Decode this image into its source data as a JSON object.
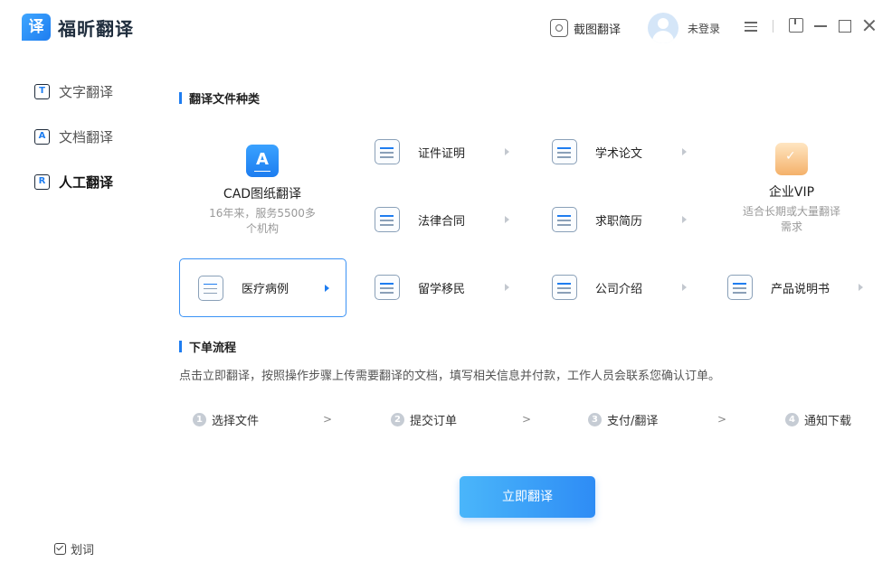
{
  "app": {
    "logo_char": "译",
    "name": "福昕翻译"
  },
  "header": {
    "screenshot_label": "截图翻译",
    "login_label": "未登录"
  },
  "sidebar": {
    "items": [
      {
        "label": "文字翻译",
        "icon": "T"
      },
      {
        "label": "文档翻译",
        "icon": "A"
      },
      {
        "label": "人工翻译",
        "icon": "R"
      }
    ],
    "huaci_label": "划词"
  },
  "file_types": {
    "title": "翻译文件种类",
    "cad": {
      "title": "CAD图纸翻译",
      "desc_line1": "16年来，服务5500多",
      "desc_line2": "个机构"
    },
    "vip": {
      "title": "企业VIP",
      "desc_line1": "适合长期或大量翻译",
      "desc_line2": "需求"
    },
    "items": [
      {
        "label": "证件证明"
      },
      {
        "label": "学术论文"
      },
      {
        "label": "法律合同"
      },
      {
        "label": "求职简历"
      },
      {
        "label": "医疗病例"
      },
      {
        "label": "留学移民"
      },
      {
        "label": "公司介绍"
      },
      {
        "label": "产品说明书"
      }
    ]
  },
  "process": {
    "title": "下单流程",
    "desc": "点击立即翻译，按照操作步骤上传需要翻译的文档，填写相关信息并付款，工作人员会联系您确认订单。",
    "separator": ">",
    "steps": [
      {
        "num": "1",
        "label": "选择文件"
      },
      {
        "num": "2",
        "label": "提交订单"
      },
      {
        "num": "3",
        "label": "支付/翻译"
      },
      {
        "num": "4",
        "label": "通知下载"
      }
    ]
  },
  "cta": {
    "label": "立即翻译"
  },
  "colors": {
    "accent": "#1e7df0",
    "button_start": "#4ab6fa",
    "button_end": "#2e8cf5"
  }
}
